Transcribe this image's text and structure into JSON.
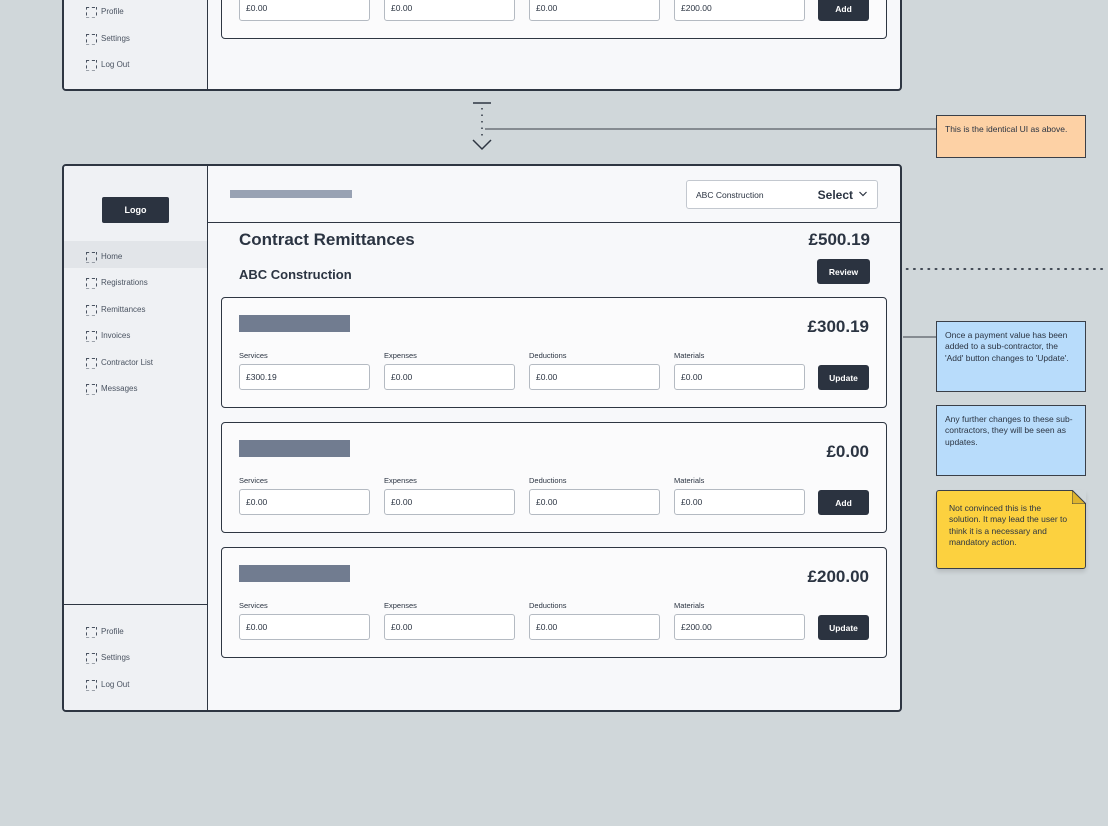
{
  "top_frame": {
    "nav_footer": [
      {
        "label": "Profile"
      },
      {
        "label": "Settings"
      },
      {
        "label": "Log Out"
      }
    ],
    "card": {
      "values": [
        "£0.00",
        "£0.00",
        "£0.00",
        "£200.00"
      ],
      "button_label": "Add"
    }
  },
  "frame": {
    "logo": "Logo",
    "nav_main": [
      {
        "label": "Home"
      },
      {
        "label": "Registrations"
      },
      {
        "label": "Remittances"
      },
      {
        "label": "Invoices"
      },
      {
        "label": "Contractor List"
      },
      {
        "label": "Messages"
      }
    ],
    "nav_footer": [
      {
        "label": "Profile"
      },
      {
        "label": "Settings"
      },
      {
        "label": "Log Out"
      }
    ],
    "company_select": {
      "value": "ABC Construction",
      "label": "Select"
    },
    "title": "Contract Remittances",
    "total": "£500.19",
    "company": "ABC Construction",
    "review_label": "Review",
    "field_labels": [
      "Services",
      "Expenses",
      "Deductions",
      "Materials"
    ],
    "cards": [
      {
        "total": "£300.19",
        "values": [
          "£300.19",
          "£0.00",
          "£0.00",
          "£0.00"
        ],
        "button_label": "Update"
      },
      {
        "total": "£0.00",
        "values": [
          "£0.00",
          "£0.00",
          "£0.00",
          "£0.00"
        ],
        "button_label": "Add"
      },
      {
        "total": "£200.00",
        "values": [
          "£0.00",
          "£0.00",
          "£0.00",
          "£200.00"
        ],
        "button_label": "Update"
      }
    ]
  },
  "annotations": {
    "identical": "This is the identical UI as above.",
    "update_change": "Once a payment value has been added to a sub-contractor, the 'Add' button changes to 'Update'.",
    "further_changes": "Any further changes to these sub-contractors, they will be seen as updates.",
    "concern": "Not convinced this is the solution. It may lead the user to think it is a necessary and mandatory action."
  },
  "colors": {
    "canvas": "#d0d7da",
    "dark_button": "#2b3340",
    "note_orange": "#fdd1a5",
    "note_blue": "#b8dcfb",
    "note_yellow": "#fcd13f"
  },
  "icons": [
    "nav-placeholder-icon",
    "chevron-down-icon",
    "arrow-down-icon",
    "folded-corner-icon"
  ]
}
